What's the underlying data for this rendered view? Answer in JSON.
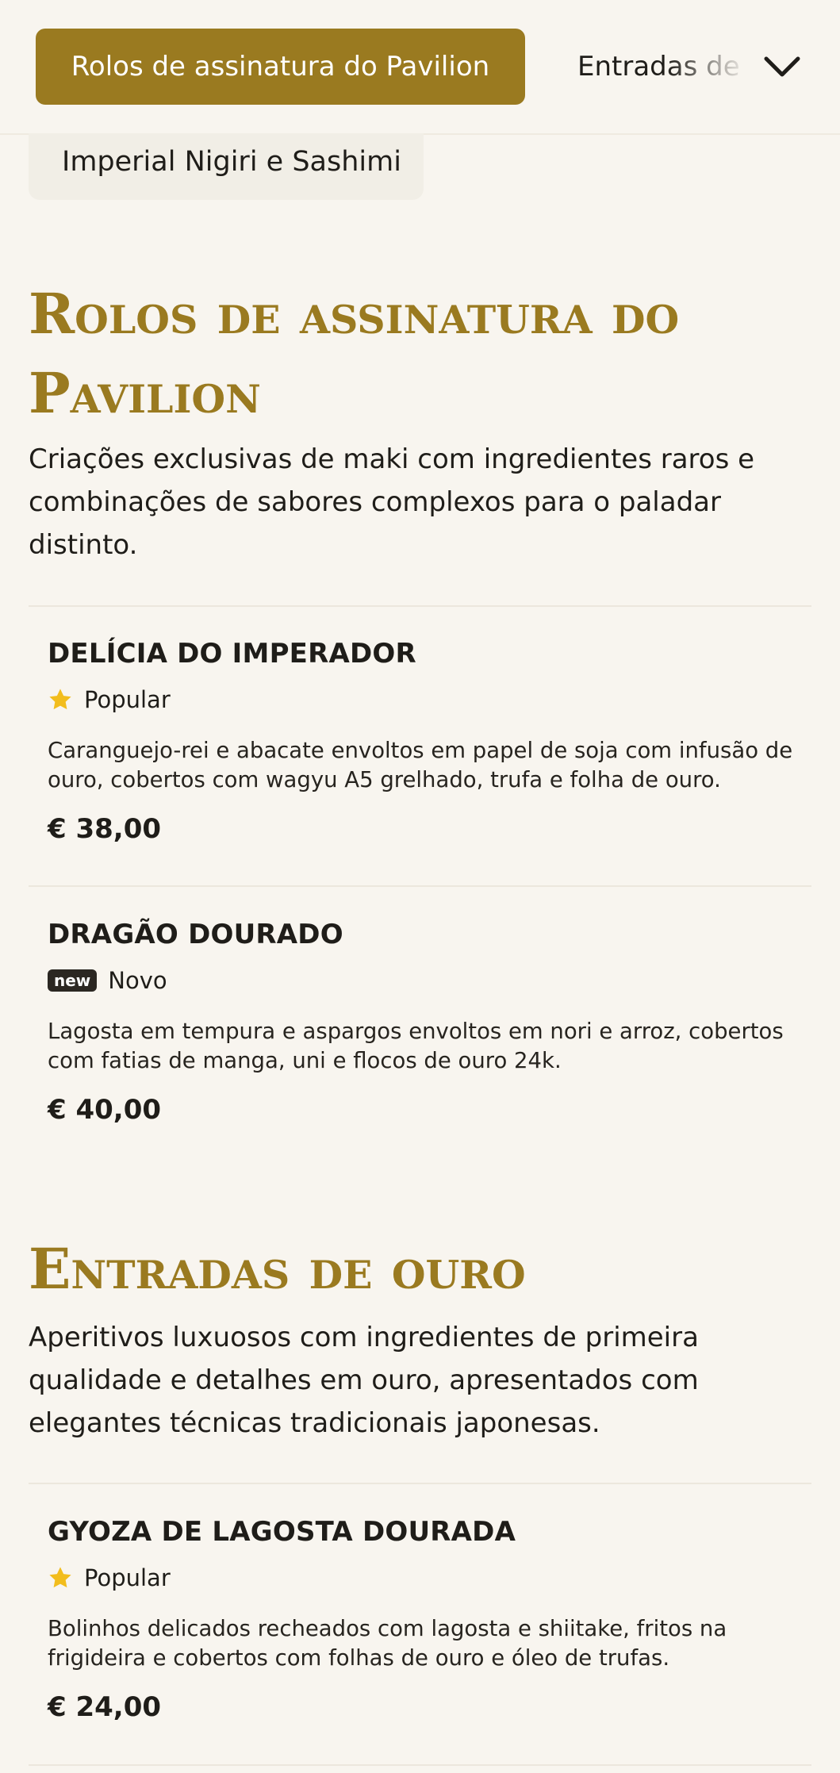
{
  "category_nav": {
    "active": "Rolos de assinatura do Pavilion",
    "next": "Entradas de",
    "chip": "Imperial Nigiri e Sashimi"
  },
  "sections": [
    {
      "title": "Rolos de assinatura do Pavilion",
      "description": "Criações exclusivas de maki com ingredientes raros e combinações de sabores complexos para o paladar distinto.",
      "items": [
        {
          "name": "DELÍCIA DO IMPERADOR",
          "badge_icon": "star-icon",
          "badge_label": "Popular",
          "description": "Caranguejo-rei e abacate envoltos em papel de soja com infusão de ouro, cobertos com wagyu A5 grelhado, trufa e folha de ouro.",
          "price": "€ 38,00"
        },
        {
          "name": "DRAGÃO DOURADO",
          "badge_pill": "new",
          "badge_label": "Novo",
          "description": "Lagosta em tempura e aspargos envoltos em nori e arroz, cobertos com fatias de manga, uni e flocos de ouro 24k.",
          "price": "€ 40,00"
        }
      ]
    },
    {
      "title": "Entradas de ouro",
      "description": "Aperitivos luxuosos com ingredientes de primeira qualidade e detalhes em ouro, apresentados com elegantes técnicas tradicionais japonesas.",
      "items": [
        {
          "name": "GYOZA DE LAGOSTA DOURADA",
          "badge_icon": "star-icon",
          "badge_label": "Popular",
          "description": "Bolinhos delicados recheados com lagosta e shiitake, fritos na frigideira e cobertos com folhas de ouro e óleo de trufas.",
          "price": "€ 24,00"
        }
      ]
    }
  ],
  "colors": {
    "background": "#f8f5ef",
    "gold": "#9a7a20",
    "star": "#f2bd1d",
    "text": "#1f1d19"
  }
}
